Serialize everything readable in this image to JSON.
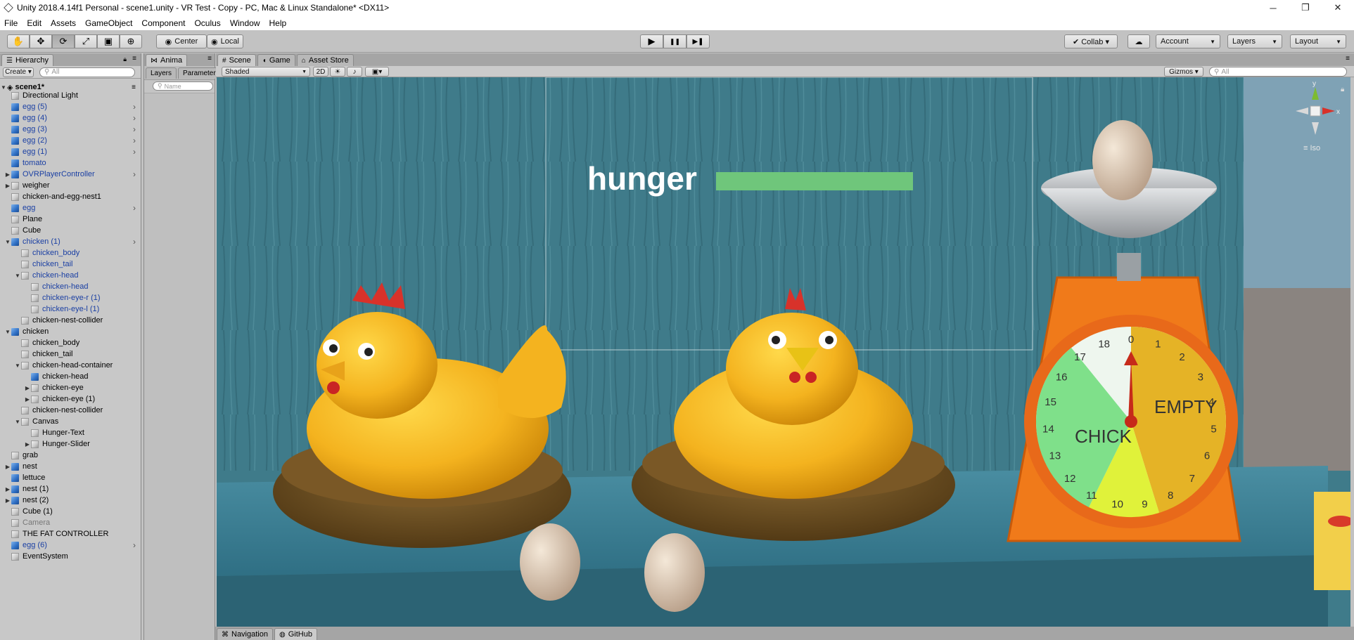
{
  "window": {
    "title": "Unity 2018.4.14f1 Personal - scene1.unity - VR Test - Copy - PC, Mac & Linux Standalone* <DX11>",
    "minimize": "─",
    "maximize": "❐",
    "close": "✕"
  },
  "menu": [
    "File",
    "Edit",
    "Assets",
    "GameObject",
    "Component",
    "Oculus",
    "Window",
    "Help"
  ],
  "toolbar": {
    "tools": [
      "✋",
      "✥",
      "⟳",
      "⤢",
      "▣",
      "⊕"
    ],
    "pivot": "Center",
    "space": "Local",
    "play": "▶",
    "pause": "❚❚",
    "step": "▶❚",
    "collab": "Collab ▾",
    "cloud": "☁",
    "account": "Account",
    "layers": "Layers",
    "layout": "Layout"
  },
  "hierarchy": {
    "tab": "Hierarchy",
    "create": "Create ▾",
    "search_placeholder": "All",
    "scene": "scene1*",
    "items": [
      {
        "label": "Directional Light",
        "indent": 1,
        "icon": "grey",
        "prefab": false
      },
      {
        "label": "egg (5)",
        "indent": 1,
        "icon": "blue",
        "prefab": true,
        "chevron": true
      },
      {
        "label": "egg (4)",
        "indent": 1,
        "icon": "blue",
        "prefab": true,
        "chevron": true
      },
      {
        "label": "egg (3)",
        "indent": 1,
        "icon": "blue",
        "prefab": true,
        "chevron": true
      },
      {
        "label": "egg (2)",
        "indent": 1,
        "icon": "blue",
        "prefab": true,
        "chevron": true
      },
      {
        "label": "egg (1)",
        "indent": 1,
        "icon": "blue",
        "prefab": true,
        "chevron": true
      },
      {
        "label": "tomato",
        "indent": 1,
        "icon": "blue",
        "prefab": true
      },
      {
        "label": "OVRPlayerController",
        "indent": 1,
        "icon": "blue",
        "prefab": true,
        "tri": "▶",
        "chevron": true
      },
      {
        "label": "weigher",
        "indent": 1,
        "icon": "grey",
        "prefab": false,
        "tri": "▶"
      },
      {
        "label": "chicken-and-egg-nest1",
        "indent": 1,
        "icon": "grey",
        "prefab": false
      },
      {
        "label": "egg",
        "indent": 1,
        "icon": "blue",
        "prefab": true,
        "chevron": true
      },
      {
        "label": "Plane",
        "indent": 1,
        "icon": "grey",
        "prefab": false
      },
      {
        "label": "Cube",
        "indent": 1,
        "icon": "grey",
        "prefab": false
      },
      {
        "label": "chicken (1)",
        "indent": 1,
        "icon": "blue",
        "prefab": true,
        "tri": "▼",
        "chevron": true
      },
      {
        "label": "chicken_body",
        "indent": 2,
        "icon": "grey",
        "prefab": true
      },
      {
        "label": "chicken_tail",
        "indent": 2,
        "icon": "grey",
        "prefab": true
      },
      {
        "label": "chicken-head",
        "indent": 2,
        "icon": "grey",
        "prefab": true,
        "tri": "▼"
      },
      {
        "label": "chicken-head",
        "indent": 3,
        "icon": "grey",
        "prefab": true
      },
      {
        "label": "chicken-eye-r (1)",
        "indent": 3,
        "icon": "grey",
        "prefab": true
      },
      {
        "label": "chicken-eye-l (1)",
        "indent": 3,
        "icon": "grey",
        "prefab": true
      },
      {
        "label": "chicken-nest-collider",
        "indent": 2,
        "icon": "grey",
        "prefab": false
      },
      {
        "label": "chicken",
        "indent": 1,
        "icon": "blue",
        "prefab": false,
        "tri": "▼"
      },
      {
        "label": "chicken_body",
        "indent": 2,
        "icon": "grey",
        "prefab": false
      },
      {
        "label": "chicken_tail",
        "indent": 2,
        "icon": "grey",
        "prefab": false
      },
      {
        "label": "chicken-head-container",
        "indent": 2,
        "icon": "grey",
        "prefab": false,
        "tri": "▼"
      },
      {
        "label": "chicken-head",
        "indent": 3,
        "icon": "blue",
        "prefab": false
      },
      {
        "label": "chicken-eye",
        "indent": 3,
        "icon": "grey",
        "prefab": false,
        "tri": "▶"
      },
      {
        "label": "chicken-eye (1)",
        "indent": 3,
        "icon": "grey",
        "prefab": false,
        "tri": "▶"
      },
      {
        "label": "chicken-nest-collider",
        "indent": 2,
        "icon": "grey",
        "prefab": false
      },
      {
        "label": "Canvas",
        "indent": 2,
        "icon": "grey",
        "prefab": false,
        "tri": "▼"
      },
      {
        "label": "Hunger-Text",
        "indent": 3,
        "icon": "grey",
        "prefab": false
      },
      {
        "label": "Hunger-Slider",
        "indent": 3,
        "icon": "grey",
        "prefab": false,
        "tri": "▶"
      },
      {
        "label": "grab",
        "indent": 1,
        "icon": "grey",
        "prefab": false
      },
      {
        "label": "nest",
        "indent": 1,
        "icon": "blue",
        "prefab": false,
        "tri": "▶"
      },
      {
        "label": "lettuce",
        "indent": 1,
        "icon": "blue",
        "prefab": false
      },
      {
        "label": "nest (1)",
        "indent": 1,
        "icon": "blue",
        "prefab": false,
        "tri": "▶"
      },
      {
        "label": "nest (2)",
        "indent": 1,
        "icon": "blue",
        "prefab": false,
        "tri": "▶"
      },
      {
        "label": "Cube (1)",
        "indent": 1,
        "icon": "grey",
        "prefab": false
      },
      {
        "label": "Camera",
        "indent": 1,
        "icon": "grey",
        "prefab": false,
        "dim": true
      },
      {
        "label": "THE FAT CONTROLLER",
        "indent": 1,
        "icon": "grey",
        "prefab": false
      },
      {
        "label": "egg (6)",
        "indent": 1,
        "icon": "blue",
        "prefab": true,
        "chevron": true
      },
      {
        "label": "EventSystem",
        "indent": 1,
        "icon": "grey",
        "prefab": false
      }
    ]
  },
  "animator": {
    "tab": "Anima",
    "layers": "Layers",
    "parameters": "Parameter",
    "name_placeholder": "Name"
  },
  "scene_tabs": {
    "scene": "Scene",
    "game": "Game",
    "asset_store": "Asset Store"
  },
  "scene_bar": {
    "shading": "Shaded",
    "mode_2d": "2D",
    "gizmos": "Gizmos ▾",
    "search_placeholder": "All"
  },
  "scene": {
    "hunger_label": "hunger",
    "hunger_level": 1.0,
    "scale_labels": {
      "left": "CHICK",
      "right": "EMPTY"
    },
    "dial_numbers": [
      "0",
      "1",
      "2",
      "3",
      "4",
      "5",
      "6",
      "7",
      "8",
      "9",
      "10",
      "11",
      "12",
      "13",
      "14",
      "15",
      "16",
      "17",
      "18"
    ],
    "gizmo": {
      "y": "y",
      "x": "x",
      "mode": "≡ Iso"
    }
  },
  "bottom_tabs": {
    "navigation": "Navigation",
    "github": "GitHub"
  },
  "colors": {
    "wall": "#3f7b8a",
    "chicken": "#f4b31f",
    "nest": "#6b4a1e",
    "scale": "#f07a1a",
    "hunger_bar": "#6fc67b",
    "dial_green": "#7fe08a",
    "dial_yellow": "#e5b326",
    "dial_lime": "#e0f23a"
  }
}
